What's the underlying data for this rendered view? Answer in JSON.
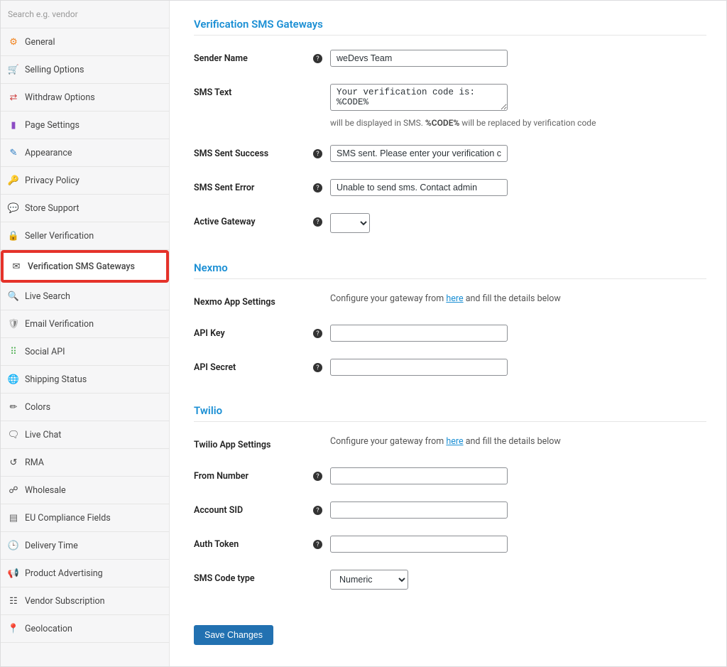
{
  "search": {
    "placeholder": "Search e.g. vendor"
  },
  "nav": {
    "items": [
      {
        "label": "General"
      },
      {
        "label": "Selling Options"
      },
      {
        "label": "Withdraw Options"
      },
      {
        "label": "Page Settings"
      },
      {
        "label": "Appearance"
      },
      {
        "label": "Privacy Policy"
      },
      {
        "label": "Store Support"
      },
      {
        "label": "Seller Verification"
      },
      {
        "label": "Verification SMS Gateways"
      },
      {
        "label": "Live Search"
      },
      {
        "label": "Email Verification"
      },
      {
        "label": "Social API"
      },
      {
        "label": "Shipping Status"
      },
      {
        "label": "Colors"
      },
      {
        "label": "Live Chat"
      },
      {
        "label": "RMA"
      },
      {
        "label": "Wholesale"
      },
      {
        "label": "EU Compliance Fields"
      },
      {
        "label": "Delivery Time"
      },
      {
        "label": "Product Advertising"
      },
      {
        "label": "Vendor Subscription"
      },
      {
        "label": "Geolocation"
      }
    ]
  },
  "sections": {
    "verification": {
      "title": "Verification SMS Gateways",
      "sender_name": {
        "label": "Sender Name",
        "value": "weDevs Team"
      },
      "sms_text": {
        "label": "SMS Text",
        "value": "Your verification code is: %CODE%",
        "hint_pre": "will be displayed in SMS. ",
        "hint_bold": "%CODE%",
        "hint_post": " will be replaced by verification code"
      },
      "sms_success": {
        "label": "SMS Sent Success",
        "value": "SMS sent. Please enter your verification code"
      },
      "sms_error": {
        "label": "SMS Sent Error",
        "value": "Unable to send sms. Contact admin"
      },
      "active_gateway": {
        "label": "Active Gateway",
        "value": ""
      }
    },
    "nexmo": {
      "title": "Nexmo",
      "app_settings": {
        "label": "Nexmo App Settings",
        "desc_pre": "Configure your gateway from ",
        "desc_link": "here",
        "desc_post": " and fill the details below"
      },
      "api_key": {
        "label": "API Key",
        "value": ""
      },
      "api_secret": {
        "label": "API Secret",
        "value": ""
      }
    },
    "twilio": {
      "title": "Twilio",
      "app_settings": {
        "label": "Twilio App Settings",
        "desc_pre": "Configure your gateway from ",
        "desc_link": "here",
        "desc_post": " and fill the details below"
      },
      "from_number": {
        "label": "From Number",
        "value": ""
      },
      "account_sid": {
        "label": "Account SID",
        "value": ""
      },
      "auth_token": {
        "label": "Auth Token",
        "value": ""
      },
      "sms_code_type": {
        "label": "SMS Code type",
        "value": "Numeric"
      }
    }
  },
  "buttons": {
    "save": "Save Changes"
  }
}
